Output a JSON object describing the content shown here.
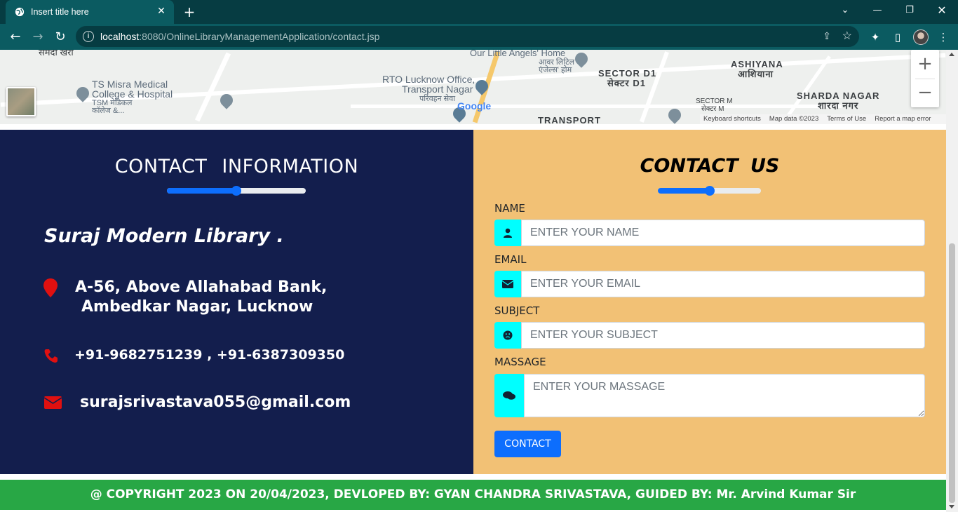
{
  "browser": {
    "tab_title": "Insert title here",
    "url_host": "localhost",
    "url_rest": ":8080/OnlineLibraryManagementApplication/contact.jsp"
  },
  "map": {
    "labels": {
      "samda": "समदा खेरा",
      "tsmisra1": "TS Misra Medical",
      "tsmisra2": "College & Hospital",
      "tsmisra3": "TSM मेडिकल",
      "tsmisra4": "कॉलेज &...",
      "rto1": "RTO Lucknow Office,",
      "rto2": "Transport Nagar",
      "rto3": "परिवहन सेवा",
      "angels1": "Our Little Angels' Home",
      "angels2": "आवर लिटिल",
      "angels3": "एंजेल्स' होम",
      "sectord1": "SECTOR D1",
      "sectord1_hi": "सेक्टर D1",
      "sectorm": "SECTOR M",
      "sectorm_hi": "सेक्टर M",
      "ashiyana": "ASHIYANA",
      "ashiyana_hi": "आशियाना",
      "sharda": "SHARDA NAGAR",
      "sharda_hi": "शारदा नगर",
      "transport": "TRANSPORT",
      "google": "Google"
    },
    "attribution": [
      "Keyboard shortcuts",
      "Map data ©2023",
      "Terms of Use",
      "Report a map error"
    ]
  },
  "contact_info": {
    "heading": "CONTACT INFORMATION",
    "library_name": "Suraj Modern Library .",
    "address_line1": "A-56, Above Allahabad Bank,",
    "address_line2": "Ambedkar Nagar, Lucknow",
    "phones": "+91-9682751239 , +91-6387309350",
    "email": "surajsrivastava055@gmail.com",
    "slider_value": 0.5
  },
  "contact_form": {
    "heading": "CONTACT US",
    "slider_value": 0.5,
    "name_label": "NAME",
    "name_placeholder": "ENTER YOUR NAME",
    "email_label": "EMAIL",
    "email_placeholder": "ENTER YOUR EMAIL",
    "subject_label": "SUBJECT",
    "subject_placeholder": "ENTER YOUR SUBJECT",
    "message_label": "MASSAGE",
    "message_placeholder": "ENTER YOUR MASSAGE",
    "submit_label": "CONTACT",
    "accent_color": "#00ffff",
    "button_color": "#0d6efd"
  },
  "footer": {
    "text": "@ COPYRIGHT 2023 ON 20/04/2023, DEVLOPED BY: GYAN CHANDRA SRIVASTAVA, GUIDED BY: Mr. Arvind Kumar Sir"
  }
}
